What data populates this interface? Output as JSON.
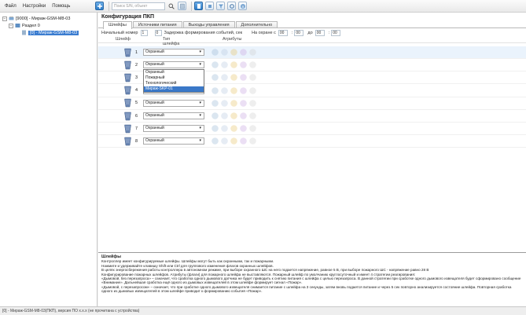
{
  "menu": [
    "Файл",
    "Настройки",
    "Помощь"
  ],
  "toolbar": {
    "search_placeholder": "Поиск S/N, объект"
  },
  "tree": {
    "root": "[9000] - Мираж-GSM-M8-03",
    "section": "Раздел 0",
    "device": "[0] - Мираж-GSM-M8-03"
  },
  "page": {
    "title": "Конфигурация ПКП"
  },
  "tabs": [
    "Шлейфы",
    "Источники питания",
    "Выходы управления",
    "Дополнительно"
  ],
  "params": {
    "start_label": "Начальный номер",
    "start_value": "1",
    "delay_label": "Задержка формирования событий, сек",
    "delay_value": "0",
    "guard_label": "На охране с",
    "from_h": "00",
    "from_m": "00",
    "to_label": "до",
    "to_h": "00",
    "to_m": "00"
  },
  "columns": {
    "zone": "Шлейф",
    "type": "Тип шлейфа",
    "attrs": "Атрибуты"
  },
  "zones": [
    {
      "num": "1",
      "type": "Охранный"
    },
    {
      "num": "2",
      "type": "Охранный"
    },
    {
      "num": "3",
      "type": "Охранный"
    },
    {
      "num": "4",
      "type": "Охранный"
    },
    {
      "num": "5",
      "type": "Охранный"
    },
    {
      "num": "6",
      "type": "Охранный"
    },
    {
      "num": "7",
      "type": "Охранный"
    },
    {
      "num": "8",
      "type": "Охранный"
    }
  ],
  "dropdown": [
    "Охранный",
    "Пожарный",
    "Технологический",
    "Мираж-SKP-01"
  ],
  "description": {
    "heading": "Шлейфы",
    "lines": [
      "Контроллер имеет конфигурируемые шлейфы. Шлейфы могут быть как охранными, так и пожарными.",
      "Нажмите и удерживайте клавишу Shift или Ctrl для группового изменения флагов охранных шлейфов.",
      "В целях энергосбережения работы контроллера в автономном режиме, при выборе охранного ШС на него подается напряжение, равное 5 В, при выборе пожарного ШС - напряжение равно 28 В",
      "Конфигурирование пожарных шлейфов. Атрибуты (флаги) для пожарного шлейфа не выставляются. Пожарный шлейф по умолчанию круглосуточный и имеет 4 стратегии реагирования:",
      "«Дымовой, без перезапроса» – означает, что сработка одного дымового датчика не будет приводить к снятию питания с шлейфа с целью перезапроса. В данной стратегии при сработке одного дымового извещателя будет сформировано сообщение «Внимание». Дальнейшая сработка ещё одного из дымовых извещателей в этом шлейфе формирует сигнал «Пожар».",
      "«Дымовой, с перезапросом» – означает, что при сработке одного дымового извещателя снимается питание с шлейфа на 3 секунды, затем вновь подается питание и через 5 сек повторно анализируется состояние шлейфа. Повторная сработка одного из дымовых извещателей в этом шлейфе приводит к формированию события «Пожар»."
    ]
  },
  "status": "[0] - Мираж-GSM-M8-03(ПКП), версия ПО x.x.x (не прочитана с устройства)"
}
